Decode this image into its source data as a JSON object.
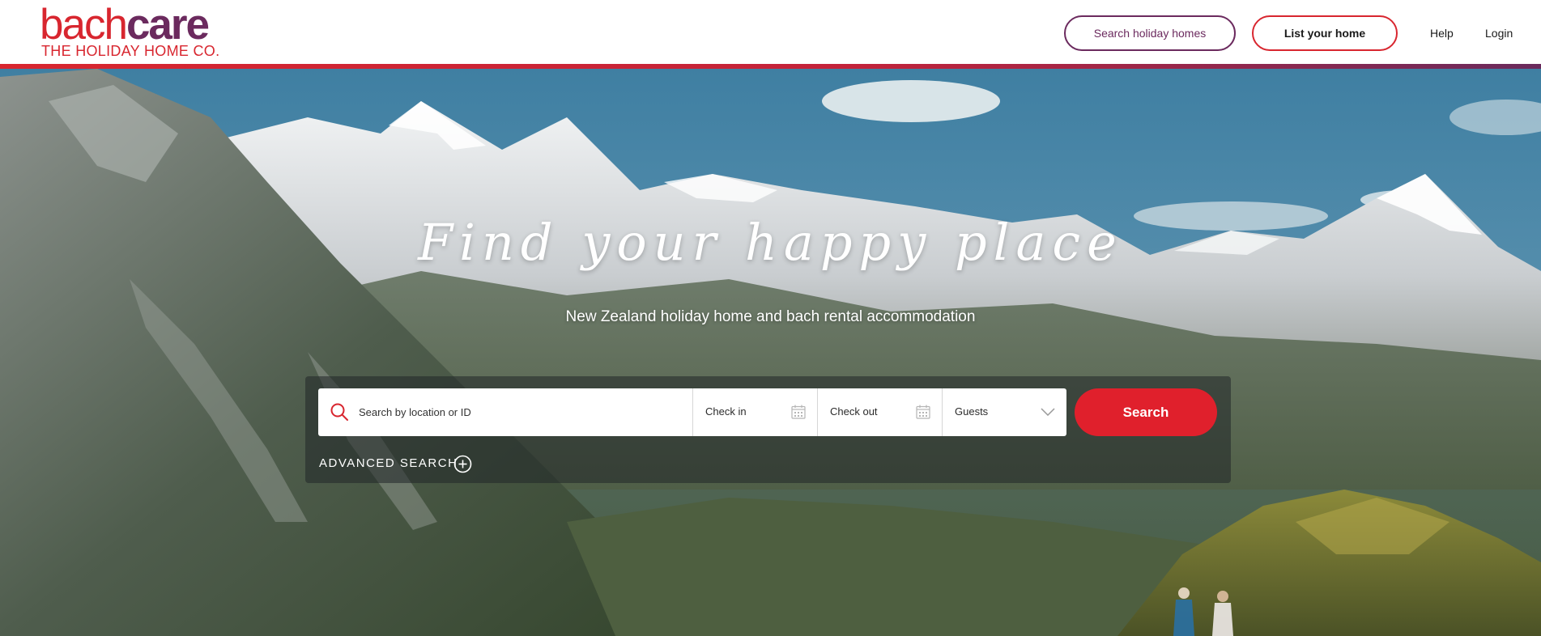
{
  "brand": {
    "logo_part1": "bach",
    "logo_part2": "care",
    "tagline": "THE HOLIDAY HOME CO.",
    "primary_color": "#d8262f",
    "secondary_color": "#6b2a5e"
  },
  "nav": {
    "search_homes_label": "Search holiday homes",
    "list_home_label": "List your home",
    "help_label": "Help",
    "login_label": "Login"
  },
  "hero": {
    "headline": "Find your happy place",
    "subheadline": "New Zealand holiday home and bach rental accommodation"
  },
  "search": {
    "location_placeholder": "Search by location or ID",
    "location_value": "",
    "checkin_label": "Check in",
    "checkout_label": "Check out",
    "guests_label": "Guests",
    "button_label": "Search",
    "button_color": "#e0202c",
    "advanced_label": "ADVANCED SEARCH"
  },
  "icons": {
    "search": "search-icon",
    "calendar": "calendar-icon",
    "chevron": "chevron-down-icon",
    "advanced": "plus-circle-icon"
  }
}
